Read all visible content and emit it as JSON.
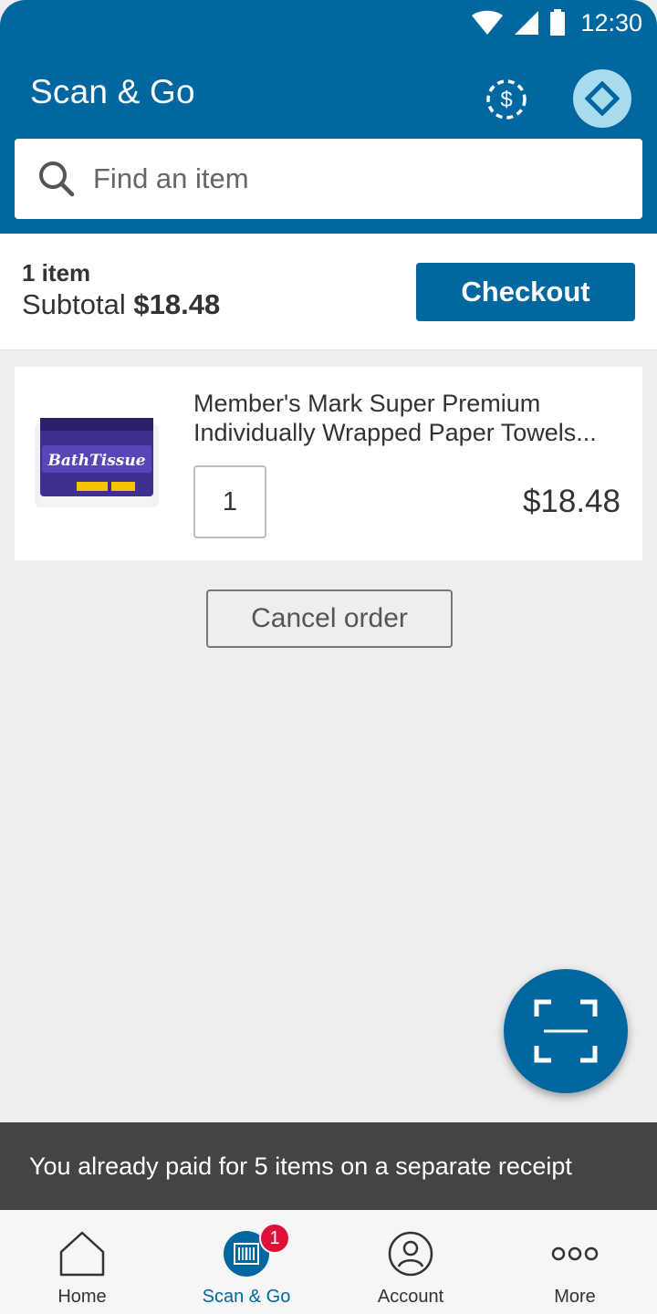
{
  "status_bar": {
    "time": "12:30"
  },
  "header": {
    "title": "Scan & Go",
    "search": {
      "placeholder": "Find an item",
      "value": ""
    }
  },
  "summary": {
    "item_count": "1 item",
    "subtotal_label": "Subtotal",
    "subtotal_amount": "$18.48",
    "checkout_label": "Checkout"
  },
  "cart": {
    "items": [
      {
        "name": "Member's Mark Super Premium Individually Wrapped Paper Towels...",
        "quantity": "1",
        "price": "$18.48",
        "image_icon": "bath-tissue-package-image"
      }
    ]
  },
  "cancel_label": "Cancel order",
  "snackbar": {
    "message": "You already paid for 5 items on a separate receipt"
  },
  "bottom_nav": {
    "items": [
      {
        "label": "Home",
        "icon": "home-icon"
      },
      {
        "label": "Scan & Go",
        "icon": "barcode-icon",
        "badge": "1"
      },
      {
        "label": "Account",
        "icon": "account-icon"
      },
      {
        "label": "More",
        "icon": "more-icon"
      }
    ]
  },
  "colors": {
    "brand_blue": "#0067a0",
    "light_blue": "#a9dcef",
    "badge_red": "#e0103a",
    "snackbar": "#444444"
  }
}
